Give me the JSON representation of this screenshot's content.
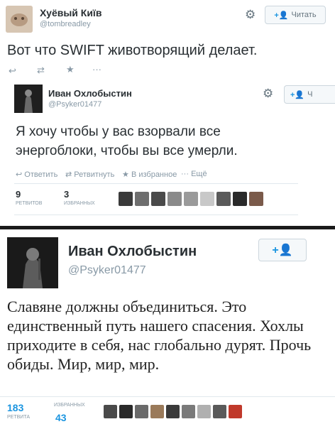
{
  "tweet1": {
    "display_name": "Хуёвый Київ",
    "handle": "@tombreadley",
    "follow_label": "Читать",
    "text": "Вот что SWIFT животворящий делает."
  },
  "tweet2": {
    "display_name": "Иван Охлобыстин",
    "handle": "@Psyker01477",
    "follow_label": "Ч",
    "text": "Я хочу чтобы у вас взорвали все энергоблоки, чтобы вы все умерли.",
    "actions": {
      "reply": "Ответить",
      "retweet": "Ретвитнуть",
      "favorite": "В избранное",
      "more": "Ещё"
    },
    "retweets_count": "9",
    "retweets_label": "РЕТВИТОВ",
    "favorites_count": "3",
    "favorites_label": "ИЗБРАННЫХ"
  },
  "tweet3": {
    "display_name": "Иван Охлобыстин",
    "handle": "@Psyker01477",
    "text": "Славяне должны объединиться. Это единственный путь нашего спасения. Хохлы приходите в себя, нас глобально дурят. Прочь обиды. Мир, мир, мир.",
    "retweets_count": "183",
    "retweets_label": "РЕТВИТА",
    "favorites_count": "43",
    "favorites_label": "ИЗБРАННЫХ"
  },
  "icons": [
    "gear-icon",
    "follow-user-icon",
    "reply-icon",
    "retweet-icon",
    "favorite-icon",
    "more-icon"
  ],
  "colors": {
    "accent": "#1b95e0",
    "muted": "#8899a6",
    "text": "#292f33",
    "divider": "#1a1a1a"
  }
}
